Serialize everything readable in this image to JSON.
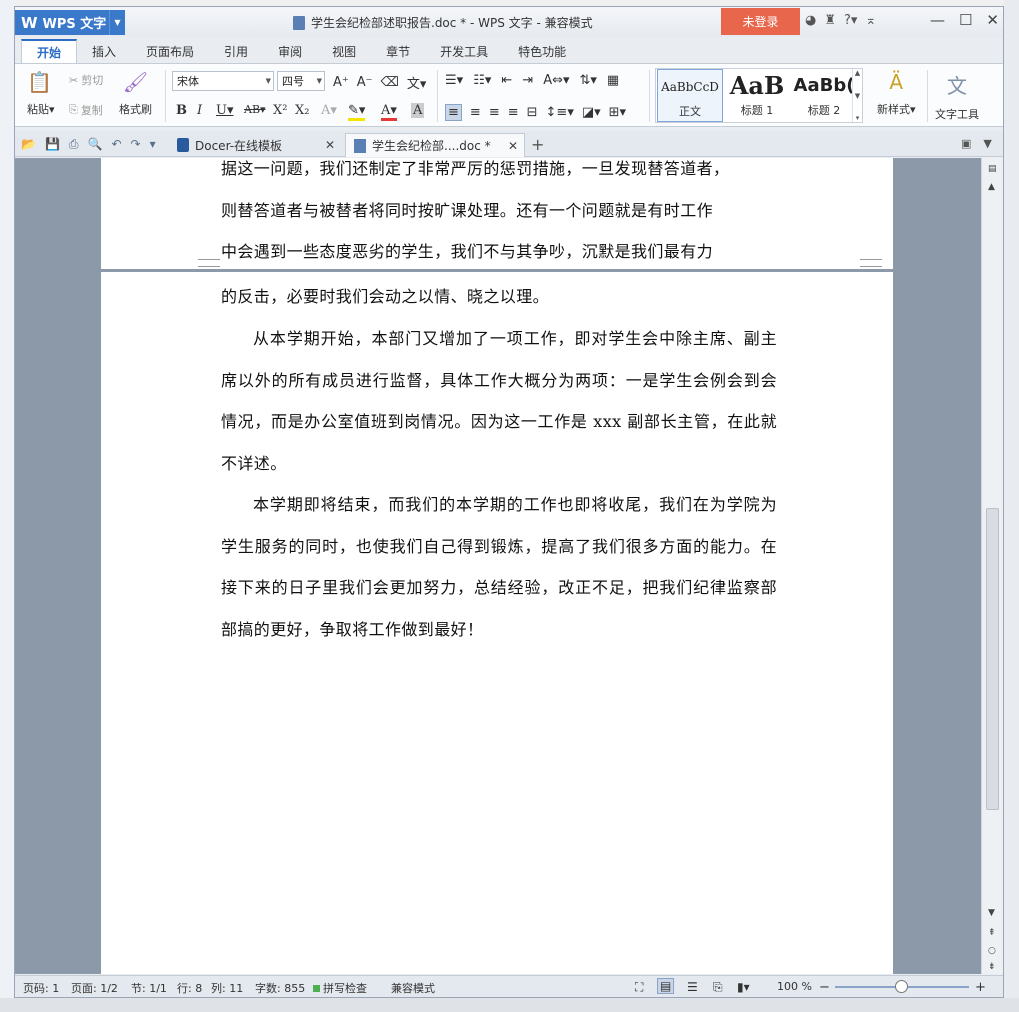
{
  "window": {
    "app_name": "WPS 文字",
    "title": "学生会纪检部述职报告.doc * - WPS 文字 - 兼容模式",
    "login_label": "未登录"
  },
  "ribbon_tabs": [
    "开始",
    "插入",
    "页面布局",
    "引用",
    "审阅",
    "视图",
    "章节",
    "开发工具",
    "特色功能"
  ],
  "ribbon": {
    "paste": "粘贴",
    "cut": "剪切",
    "copy": "复制",
    "format_painter": "格式刷",
    "font_name": "宋体",
    "font_size": "四号",
    "styles": [
      {
        "sample": "AaBbCcD",
        "name": "正文"
      },
      {
        "sample": "AaB",
        "name": "标题 1"
      },
      {
        "sample": "AaBb(",
        "name": "标题 2"
      }
    ],
    "new_style": "新样式",
    "text_tools": "文字工具"
  },
  "doc_tabs": [
    {
      "label": "Docer-在线模板"
    },
    {
      "label": "学生会纪检部....doc *"
    }
  ],
  "document": {
    "prev_page_lines": [
      "据这一问题，我们还制定了非常严厉的惩罚措施，一旦发现替答道者，",
      "则替答道者与被替者将同时按旷课处理。还有一个问题就是有时工作",
      "中会遇到一些态度恶劣的学生，我们不与其争吵，沉默是我们最有力"
    ],
    "paragraphs": [
      "的反击，必要时我们会动之以情、晓之以理。",
      "从本学期开始，本部门又增加了一项工作，即对学生会中除主席、副主席以外的所有成员进行监督，具体工作大概分为两项：一是学生会例会到会情况，而是办公室值班到岗情况。因为这一工作是 xxx 副部长主管，在此就不详述。",
      "本学期即将结束，而我们的本学期的工作也即将收尾，我们在为学院为学生服务的同时，也使我们自己得到锻炼，提高了我们很多方面的能力。在接下来的日子里我们会更加努力，总结经验，改正不足，把我们纪律监察部部搞的更好，争取将工作做到最好！"
    ]
  },
  "status_bar": {
    "page_code": "页码: 1",
    "page": "页面: 1/2",
    "section": "节: 1/1",
    "row": "行: 8",
    "col": "列: 11",
    "word_count": "字数: 855",
    "spell_check": "拼写检查",
    "compat_mode": "兼容模式",
    "zoom": "100 %"
  }
}
